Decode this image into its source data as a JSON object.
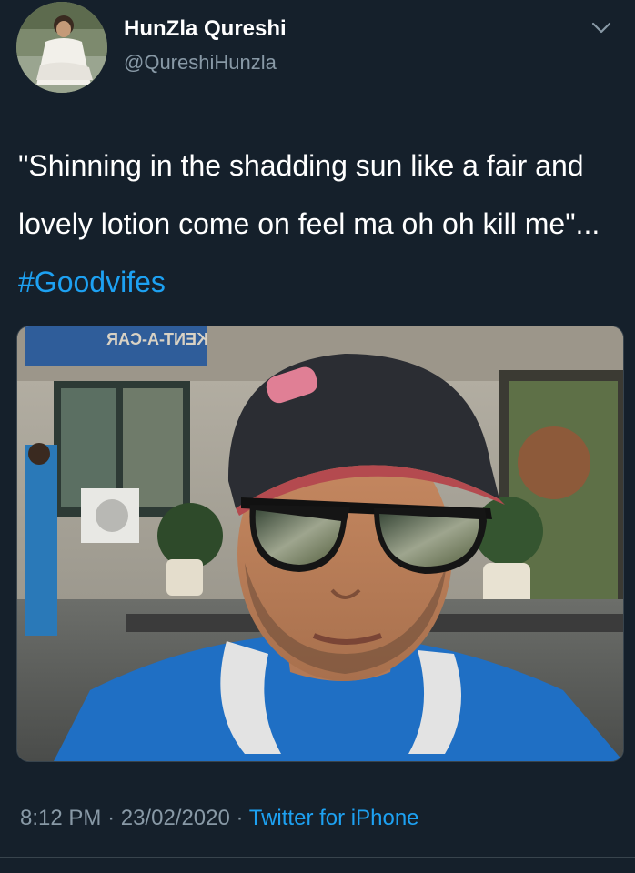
{
  "tweet": {
    "author": {
      "name": "HunZla Qureshi",
      "handle": "@QureshiHunzla",
      "avatar_icon": "profile-avatar"
    },
    "text": "\"Shinning in the shadding sun like a fair and lovely lotion come on feel ma oh oh kill me\"... ",
    "hashtag": "#Goodvifes",
    "media": {
      "icon": "photo",
      "sign_text": "KENT-A-CAR"
    },
    "time": "8:12 PM",
    "date": "23/02/2020",
    "separator": "·",
    "source": "Twitter for iPhone"
  },
  "colors": {
    "background": "#15202b",
    "link": "#1da1f2",
    "secondary_text": "#8899a6"
  }
}
